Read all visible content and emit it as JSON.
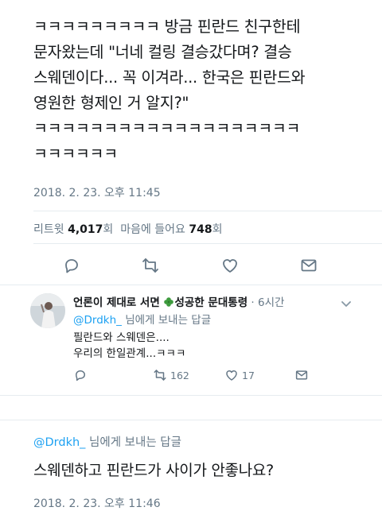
{
  "tweet": {
    "text": "ㅋㅋㅋㅋㅋㅋㅋㅋㅋ 방금 핀란드 친구한테\n문자왔는데 \"너네 컬링 결승갔다며? 결승\n스웨덴이다... 꼭 이겨라... 한국은 핀란드와\n영원한 형제인 거 알지?\"\nㅋㅋㅋㅋㅋㅋㅋㅋㅋㅋㅋㅋㅋㅋㅋㅋㅋㅋㅋ\nㅋㅋㅋㅋㅋㅋ",
    "timestamp": "2018. 2. 23. 오후 11:45",
    "retweets_label": "리트윗",
    "retweets_count": "4,017",
    "retweets_unit": "회",
    "likes_label": "마음에 들어요",
    "likes_count": "748",
    "likes_unit": "회"
  },
  "reply": {
    "name_part1": "언론이 제대로 서면",
    "name_part2": "성공한 문대통령",
    "time": "· 6시간",
    "reply_to_handle": "@Drdkh_",
    "reply_to_suffix": " 님에게 보내는 답글",
    "text": "필란드와 스웨덴은....\n우리의 한일관계...ㅋㅋㅋ",
    "retweet_count": "162",
    "like_count": "17"
  },
  "focus_reply": {
    "reply_to_handle": "@Drdkh_",
    "reply_to_suffix": " 님에게 보내는 답글",
    "text": "스웨덴하고 핀란드가 사이가 안좋나요?",
    "timestamp": "2018. 2. 23. 오후 11:46"
  },
  "colors": {
    "link": "#1da1f2",
    "muted": "#657786",
    "text": "#14171a"
  },
  "icons": [
    "reply-icon",
    "retweet-icon",
    "heart-icon",
    "message-icon",
    "clover-icon",
    "chevron-down-icon"
  ]
}
